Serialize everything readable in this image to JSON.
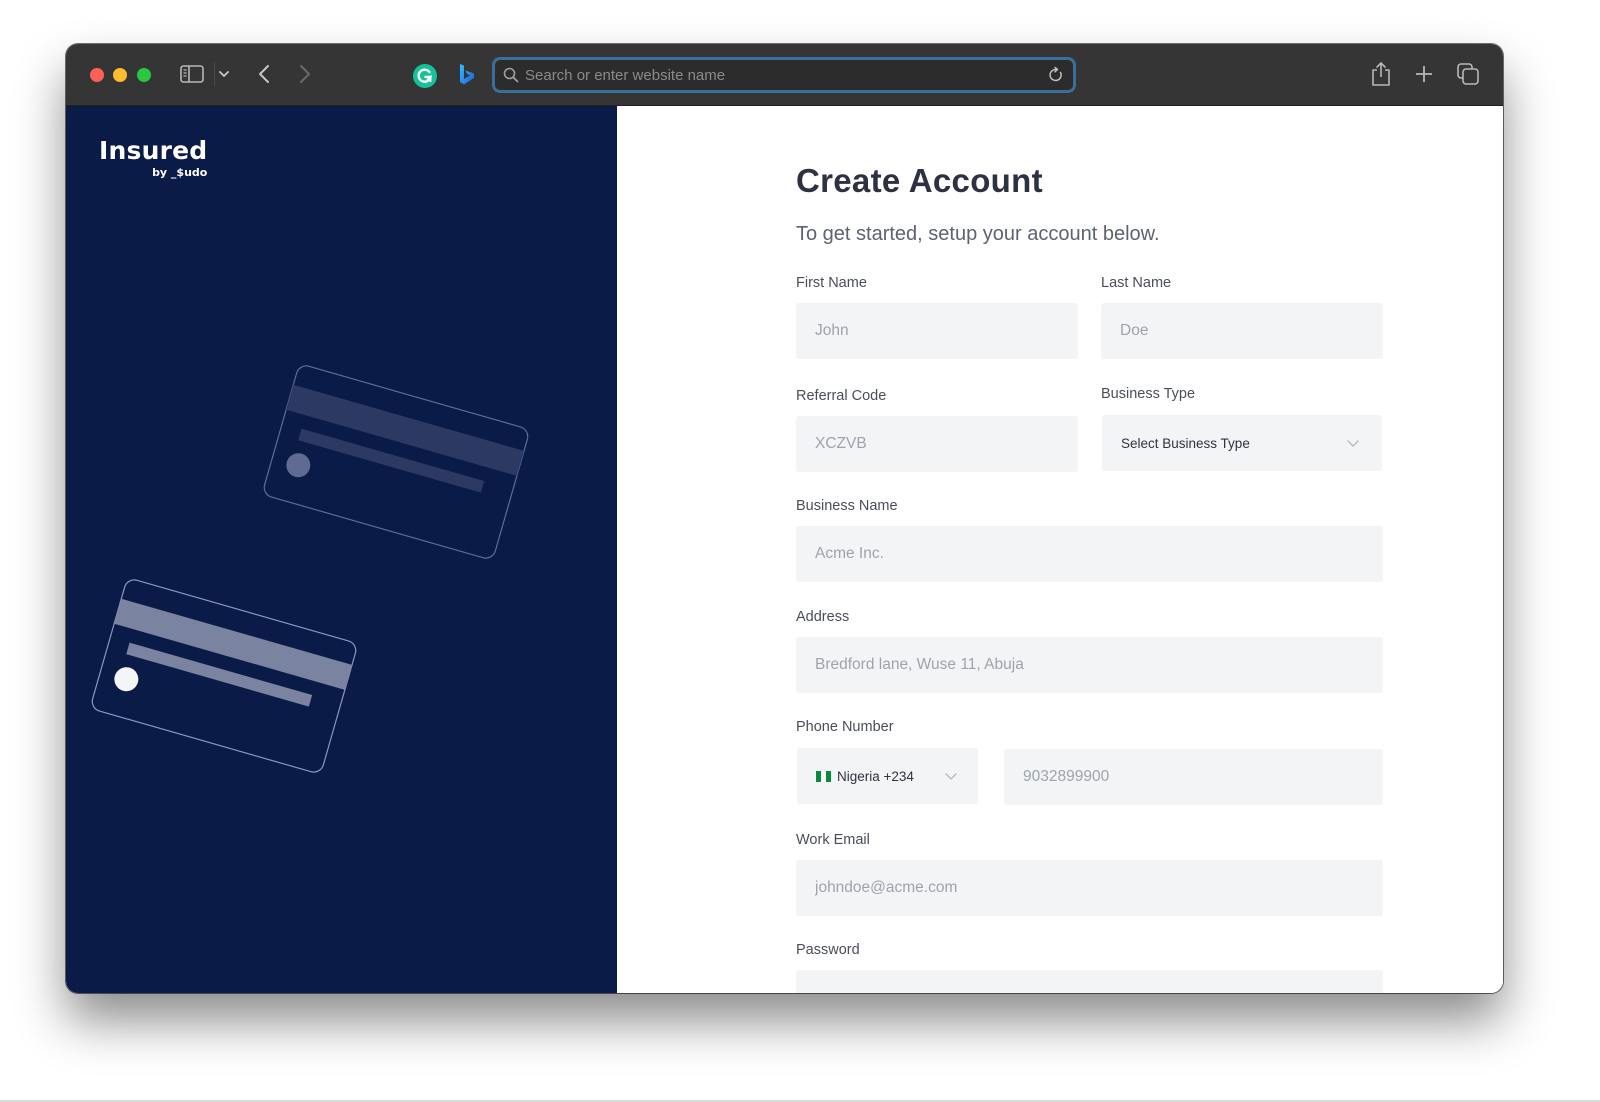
{
  "browser": {
    "url_placeholder": "Search or enter website name",
    "icons": {
      "sidebar": "sidebar-icon",
      "tab_menu": "chevron-down-icon",
      "back": "chevron-left-icon",
      "forward": "chevron-right-icon",
      "extension1": "grammarly-icon",
      "extension2": "bing-icon",
      "search": "search-icon",
      "reload": "reload-icon",
      "share": "share-icon",
      "new_tab": "plus-icon",
      "tab_overview": "tabs-icon"
    }
  },
  "brand": {
    "name": "Insured",
    "byline": "by _$udo",
    "panel_color": "#0a1b48"
  },
  "form": {
    "title": "Create Account",
    "subtitle": "To get started, setup your account below.",
    "fields": {
      "first_name": {
        "label": "First Name",
        "placeholder": "John",
        "value": ""
      },
      "last_name": {
        "label": "Last Name",
        "placeholder": "Doe",
        "value": ""
      },
      "referral_code": {
        "label": "Referral Code",
        "placeholder": "XCZVB",
        "value": ""
      },
      "business_type": {
        "label": "Business Type",
        "selected": "Select Business Type"
      },
      "business_name": {
        "label": "Business Name",
        "placeholder": "Acme Inc.",
        "value": ""
      },
      "address": {
        "label": "Address",
        "placeholder": "Bredford lane, Wuse 11, Abuja",
        "value": ""
      },
      "phone": {
        "label": "Phone Number",
        "country_selected": "Nigeria +234",
        "country_flag": "nigeria-flag-icon",
        "placeholder": "9032899900",
        "value": ""
      },
      "work_email": {
        "label": "Work Email",
        "placeholder": "johndoe@acme.com",
        "value": ""
      },
      "password": {
        "label": "Password",
        "placeholder": "",
        "value": ""
      }
    }
  }
}
